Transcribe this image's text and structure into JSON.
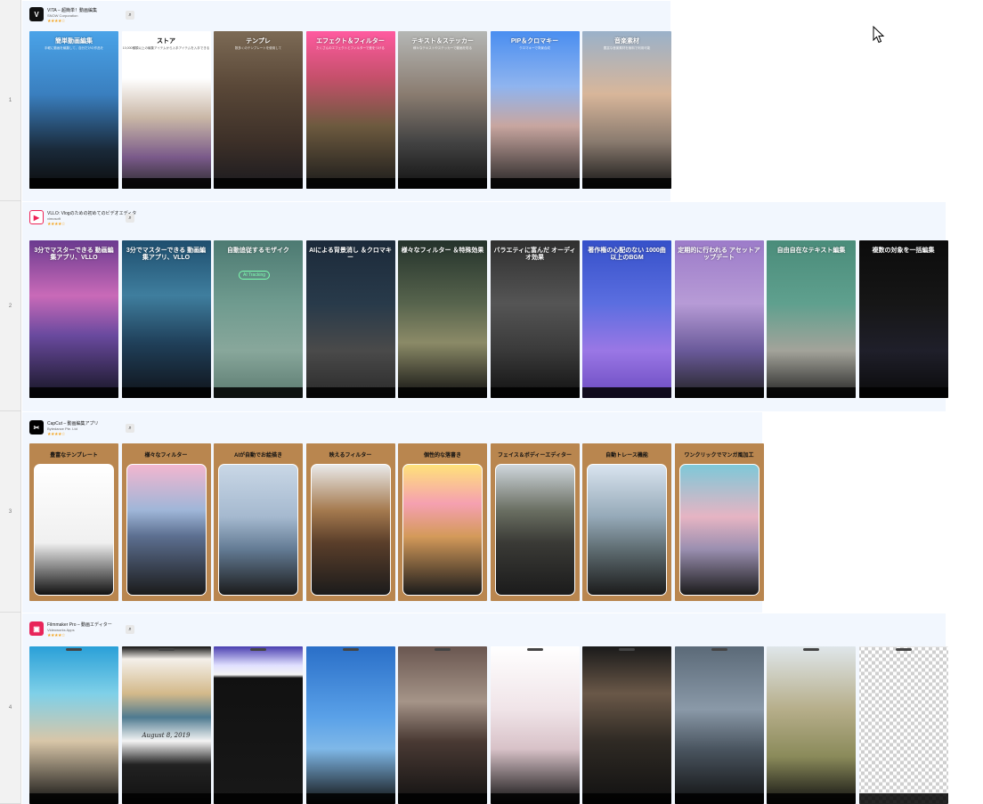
{
  "rows": [
    {
      "num": "1",
      "app": {
        "name": "VITA – 超簡単！動画編集",
        "developer": "SNOW Corporation",
        "stars": "★★★★☆",
        "icon_glyph": "V",
        "icon_color": "#111111"
      },
      "screens": [
        {
          "title": "簡単動画編集",
          "subtitle": "手軽に動画を編集して、自分だけの作品を",
          "bg": "linear-gradient(180deg,#4aa3e8 0%,#3a7fbf 40%,#1a2a3a 75%,#0c0c0c 100%)"
        },
        {
          "title": "ストア",
          "subtitle": "10,000種類以上の編集アイテムから入手アイテムを入手できる",
          "bg": "linear-gradient(180deg,#ffffff 0%,#ffffff 30%,#c9b7a6 55%,#7a5a8a 80%,#2a2a2a 100%)",
          "dark": true
        },
        {
          "title": "テンプレ",
          "subtitle": "数多くのテンプレートを使用して",
          "bg": "linear-gradient(180deg,#7c6a55 0%,#5a4838 35%,#3d3028 70%,#1b1a1f 100%)"
        },
        {
          "title": "エフェクト＆フィルター",
          "subtitle": "たくさんのエフェクトとフィルターで差をつける",
          "bg": "linear-gradient(180deg,#ff5aa0 0%,#c4506a 30%,#6d5a3f 60%,#1a1a1a 100%)"
        },
        {
          "title": "テキスト＆ステッカー",
          "subtitle": "様々なテキストやステッカーで動画を彩る",
          "bg": "linear-gradient(180deg,#b5b7b5 0%,#8a7c70 40%,#444 70%,#111 100%)"
        },
        {
          "title": "PIP＆クロマキー",
          "subtitle": "クロマキーで背景合成",
          "bg": "linear-gradient(180deg,#4a8ef0 0%,#8fb4ef 35%,#c8a6a0 60%,#222 100%)"
        },
        {
          "title": "音楽素材",
          "subtitle": "豊富な音楽素材を無料で利用可能",
          "bg": "linear-gradient(180deg,#9ab1c9 0%,#d8b69a 40%,#8a7b6f 70%,#141414 100%)"
        }
      ]
    },
    {
      "num": "2",
      "app": {
        "name": "VLLO: Vlogのための初めてのビデオエディタ",
        "developer": "vimosoft",
        "stars": "★★★★☆",
        "icon_glyph": "▶",
        "icon_color": "#ffffff",
        "icon_fg": "#ee2255"
      },
      "screens": [
        {
          "title": "3分でマスターできる 動画編集アプリ、VLLO",
          "bg": "linear-gradient(180deg,#6a3a8f 0%,#c96ab8 35%,#6a4a9f 60%,#151522 100%)"
        },
        {
          "title": "3分でマスターできる 動画編集アプリ、VLLO",
          "bg": "linear-gradient(180deg,#1e4e6e 0%,#3f7e9e 35%,#20405a 65%,#0f1218 100%)"
        },
        {
          "title": "自動追従するモザイク",
          "badge": "AI Tracking",
          "bg": "linear-gradient(180deg,#4d7a72 0%,#6f9b8f 40%,#88a79b 70%,#5b7a70 100%)"
        },
        {
          "title": "AIによる背景消し ＆クロマキー",
          "bg": "linear-gradient(180deg,#1c2a3a 0%,#283a4a 40%,#4a4a4a 70%,#2a2a2a 100%)"
        },
        {
          "title": "様々なフィルター ＆特殊効果",
          "bg": "linear-gradient(180deg,#24322b 0%,#57644d 40%,#8b8a67 65%,#111 100%)"
        },
        {
          "title": "バラエティに富んだ オーディオ効果",
          "bg": "linear-gradient(180deg,#2f2f2f 0%,#555 40%,#3a3a3a 70%,#111 100%)"
        },
        {
          "title": "著作権の心配のない 1000曲以上のBGM",
          "highlight": "1000",
          "bg": "linear-gradient(180deg,#3550c9 0%,#5b6ee0 40%,#9a77e5 70%,#6a4ac0 100%)"
        },
        {
          "title": "定期的に行われる アセットアップデート",
          "bg": "linear-gradient(180deg,#9c7bc9 0%,#b79bd6 40%,#6a5a9a 70%,#222 100%)"
        },
        {
          "title": "自由自在なテキスト編集",
          "bg": "linear-gradient(180deg,#4a8c7a 0%,#5fa08e 40%,#a3a39a 70%,#222 100%)"
        },
        {
          "title": "複数の対象を一括編集",
          "bg": "linear-gradient(180deg,#0c0c0c 0%,#161616 40%,#1f1f2a 70%,#0a0a0a 100%)"
        }
      ]
    },
    {
      "num": "3",
      "app": {
        "name": "CapCut – 動画編集アプリ",
        "developer": "Bytedance Pte. Ltd",
        "stars": "★★★★☆",
        "icon_glyph": "✂",
        "icon_color": "#000000"
      },
      "screens": [
        {
          "title": "豊富なテンプレート",
          "phone_bg": "linear-gradient(180deg,#fff 0%,#f0f0f0 60%,#111 100%)"
        },
        {
          "title": "様々なフィルター",
          "phone_bg": "linear-gradient(180deg,#f2b6cf 0%,#9fb6d8 35%,#5c6f90 55%,#1b1b1b 100%)"
        },
        {
          "title": "AIが自動でお絵描き",
          "phone_bg": "linear-gradient(180deg,#c9d7e6 0%,#a5b9cf 40%,#637b94 65%,#1b1b1b 100%)"
        },
        {
          "title": "映えるフィルター",
          "phone_bg": "linear-gradient(180deg,#e9e9e9 0%,#a57a4f 35%,#5a3e2a 60%,#1b1b1b 100%)"
        },
        {
          "title": "個性的な落書き",
          "phone_bg": "linear-gradient(180deg,#ffe27a 0%,#f5a0b0 30%,#d49a5a 55%,#1b1b1b 100%)"
        },
        {
          "title": "フェイス＆ボディーエディター",
          "phone_bg": "linear-gradient(180deg,#cfd6dc 0%,#6a6f62 35%,#3a3a36 60%,#1b1b1b 100%)"
        },
        {
          "title": "自動トレース機能",
          "phone_bg": "linear-gradient(180deg,#d9e4ef 0%,#95a9b8 40%,#5f6d72 65%,#1b1b1b 100%)"
        },
        {
          "title": "ワンクリックでマンガ風加工",
          "phone_bg": "linear-gradient(180deg,#7ec8d8 0%,#e6b4c3 40%,#9a8fb0 65%,#1b1b1b 100%)"
        }
      ]
    },
    {
      "num": "4",
      "app": {
        "name": "Filmmaker Pro – 動画エディター",
        "developer": "Videoworks Apps",
        "stars": "★★★★☆",
        "icon_glyph": "▣",
        "icon_color": "#e8255a"
      },
      "screens": [
        {
          "bg": "linear-gradient(180deg,#2aa0d8 0%,#7fd0e8 30%,#d8c6a8 60%,#111 100%)"
        },
        {
          "caption": "August 8, 2019",
          "bg": "linear-gradient(180deg,#111 0%,#f4f0ea 8%,#d3b98a 30%,#4e7a90 45%,#f4f4f4 60%,#222 75%,#111 100%)"
        },
        {
          "bg": "linear-gradient(180deg,#4a3fb0 0%,#e0e0ff 12%,#f4f4f4 18%,#111 20%,#181818 100%)"
        },
        {
          "bg": "linear-gradient(180deg,#2a6fc8 0%,#5aa1e8 45%,#7fb8e8 65%,#111 100%)"
        },
        {
          "bg": "linear-gradient(180deg,#6a5650 0%,#a59488 35%,#4a3a34 60%,#111 100%)"
        },
        {
          "bg": "linear-gradient(180deg,#ffffff 0%,#f0e4e8 40%,#d8c2c8 65%,#111 100%)"
        },
        {
          "bg": "linear-gradient(180deg,#1a1a1a 0%,#6a5848 30%,#2f2a24 60%,#111 100%)"
        },
        {
          "bg": "linear-gradient(180deg,#5b6a78 0%,#8a99a8 40%,#4a5560 65%,#111 100%)"
        },
        {
          "bg": "linear-gradient(180deg,#dfe6ea 0%,#b6ae8a 40%,#8a8a5a 70%,#111 100%)"
        },
        {
          "bg": "repeating-conic-gradient(#cfcfcf 0% 25%,#ffffff 0% 50%) 50% / 8px 8px"
        }
      ]
    }
  ]
}
